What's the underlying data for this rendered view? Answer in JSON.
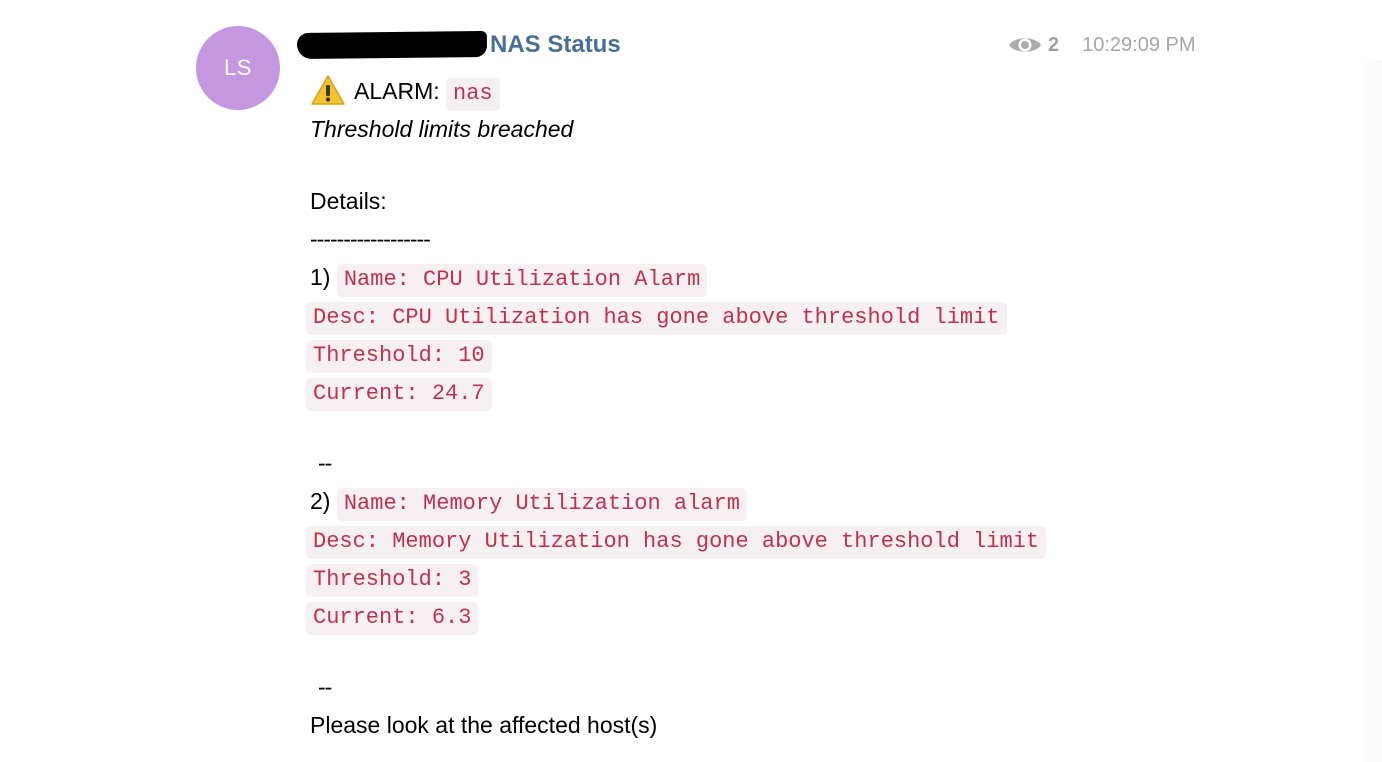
{
  "message": {
    "avatar_initials": "LS",
    "sender": "NAS Status",
    "seen_count": "2",
    "timestamp": "10:29:09 PM",
    "alarm_label": "ALARM:",
    "alarm_target": "nas",
    "subtitle": "Threshold limits breached",
    "details_label": "Details:",
    "divider": "------------------",
    "alarms": [
      {
        "index": "1)",
        "name": "Name: CPU Utilization Alarm",
        "desc": "Desc: CPU Utilization has gone above threshold limit",
        "threshold": "Threshold: 10",
        "current": "Current: 24.7"
      },
      {
        "index": "2)",
        "name": "Name: Memory Utilization alarm",
        "desc": "Desc: Memory Utilization has gone above threshold limit",
        "threshold": "Threshold: 3",
        "current": "Current: 6.3"
      }
    ],
    "separator": "--",
    "footer": "Please look at the affected host(s)"
  },
  "icons": {
    "warning": "warning-icon",
    "seen": "eye-icon"
  },
  "colors": {
    "avatar_bg": "#c497e0",
    "sender": "#4a6f96",
    "code_text": "#c0314f",
    "code_bg": "#f7f0f2",
    "meta_text": "#a6a6a6"
  }
}
